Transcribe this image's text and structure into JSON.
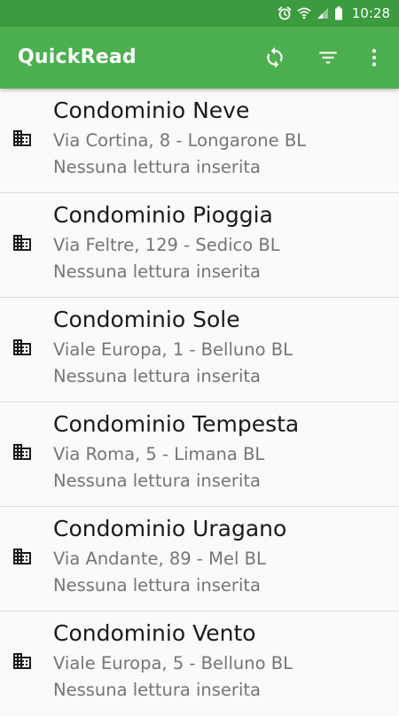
{
  "status_bar": {
    "time": "10:28",
    "icons": [
      "alarm-icon",
      "wifi-icon",
      "signal-icon",
      "battery-icon"
    ]
  },
  "app_bar": {
    "title": "QuickRead",
    "actions": [
      "refresh-icon",
      "filter-icon",
      "more-vert-icon"
    ]
  },
  "colors": {
    "primary": "#4caf50",
    "primary_dark": "#3a9b3f",
    "text_primary": "#1a1a1a",
    "text_secondary": "#757575",
    "background": "#fafafa",
    "divider": "#dcdcdc"
  },
  "items": [
    {
      "title": "Condominio Neve",
      "address": "Via Cortina, 8 - Longarone BL",
      "status": "Nessuna lettura inserita",
      "icon": "building-icon"
    },
    {
      "title": "Condominio Pioggia",
      "address": "Via Feltre, 129 - Sedico BL",
      "status": "Nessuna lettura inserita",
      "icon": "building-icon"
    },
    {
      "title": "Condominio Sole",
      "address": "Viale Europa, 1 - Belluno BL",
      "status": "Nessuna lettura inserita",
      "icon": "building-icon"
    },
    {
      "title": "Condominio Tempesta",
      "address": "Via Roma, 5 - Limana BL",
      "status": "Nessuna lettura inserita",
      "icon": "building-icon"
    },
    {
      "title": "Condominio Uragano",
      "address": "Via Andante, 89 - Mel BL",
      "status": "Nessuna lettura inserita",
      "icon": "building-icon"
    },
    {
      "title": "Condominio Vento",
      "address": "Viale Europa, 5 - Belluno BL",
      "status": "Nessuna lettura inserita",
      "icon": "building-icon"
    }
  ]
}
